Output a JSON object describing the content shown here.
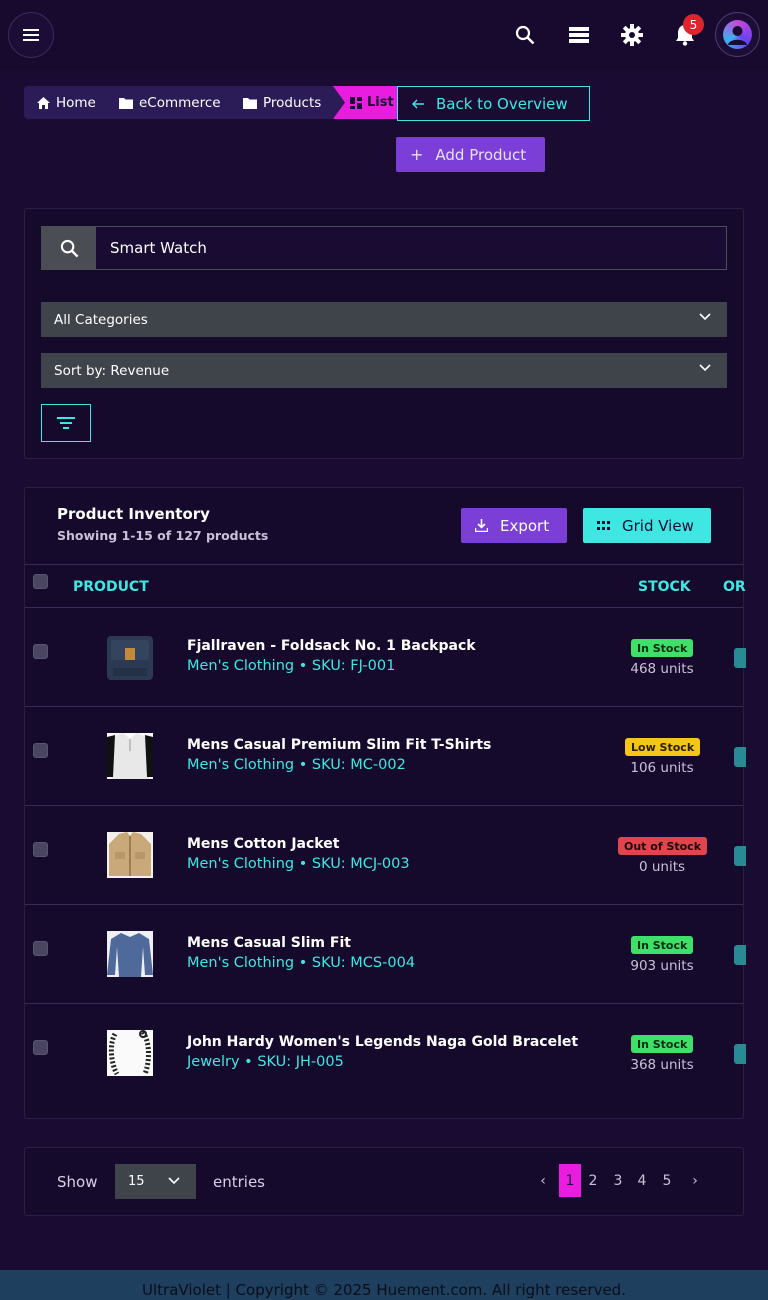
{
  "topbar": {
    "notification_count": "5",
    "icons": [
      "menu-icon",
      "search-icon",
      "layers-icon",
      "gear-icon",
      "bell-icon"
    ]
  },
  "breadcrumb": {
    "items": [
      "Home",
      "eCommerce",
      "Products"
    ],
    "active": "List"
  },
  "actions": {
    "back": "Back to Overview",
    "add": "Add Product"
  },
  "filters": {
    "search_value": "Smart Watch",
    "category": "All Categories",
    "sort": "Sort by: Revenue"
  },
  "inventory": {
    "title": "Product Inventory",
    "subtitle": "Showing 1-15 of 127 products",
    "export_label": "Export",
    "grid_label": "Grid View",
    "columns": [
      "PRODUCT",
      "STOCK",
      "OR"
    ],
    "rows": [
      {
        "name": "Fjallraven - Foldsack No. 1 Backpack",
        "meta": "Men's Clothing • SKU: FJ-001",
        "status": "In Stock",
        "units": "468 units"
      },
      {
        "name": "Mens Casual Premium Slim Fit T-Shirts",
        "meta": "Men's Clothing • SKU: MC-002",
        "status": "Low Stock",
        "units": "106 units"
      },
      {
        "name": "Mens Cotton Jacket",
        "meta": "Men's Clothing • SKU: MCJ-003",
        "status": "Out of Stock",
        "units": "0 units"
      },
      {
        "name": "Mens Casual Slim Fit",
        "meta": "Men's Clothing • SKU: MCS-004",
        "status": "In Stock",
        "units": "903 units"
      },
      {
        "name": "John Hardy Women's Legends Naga Gold Bracelet",
        "meta": "Jewelry • SKU: JH-005",
        "status": "In Stock",
        "units": "368 units"
      }
    ]
  },
  "pagination": {
    "show": "Show",
    "per_page": "15",
    "entries": "entries",
    "pages": [
      "1",
      "2",
      "3",
      "4",
      "5"
    ],
    "prev": "‹",
    "next": "›",
    "current": "1"
  },
  "footer": "UltraViolet | Copyright © 2025 Huement.com. All right reserved.",
  "colors": {
    "background": "#1a0b33",
    "accent_cyan": "#3fe7e2",
    "accent_magenta": "#e91ce0",
    "accent_purple": "#7b3fd8",
    "in_stock": "#3ee06a",
    "low_stock": "#f5c518",
    "out_of_stock": "#e0444c"
  }
}
